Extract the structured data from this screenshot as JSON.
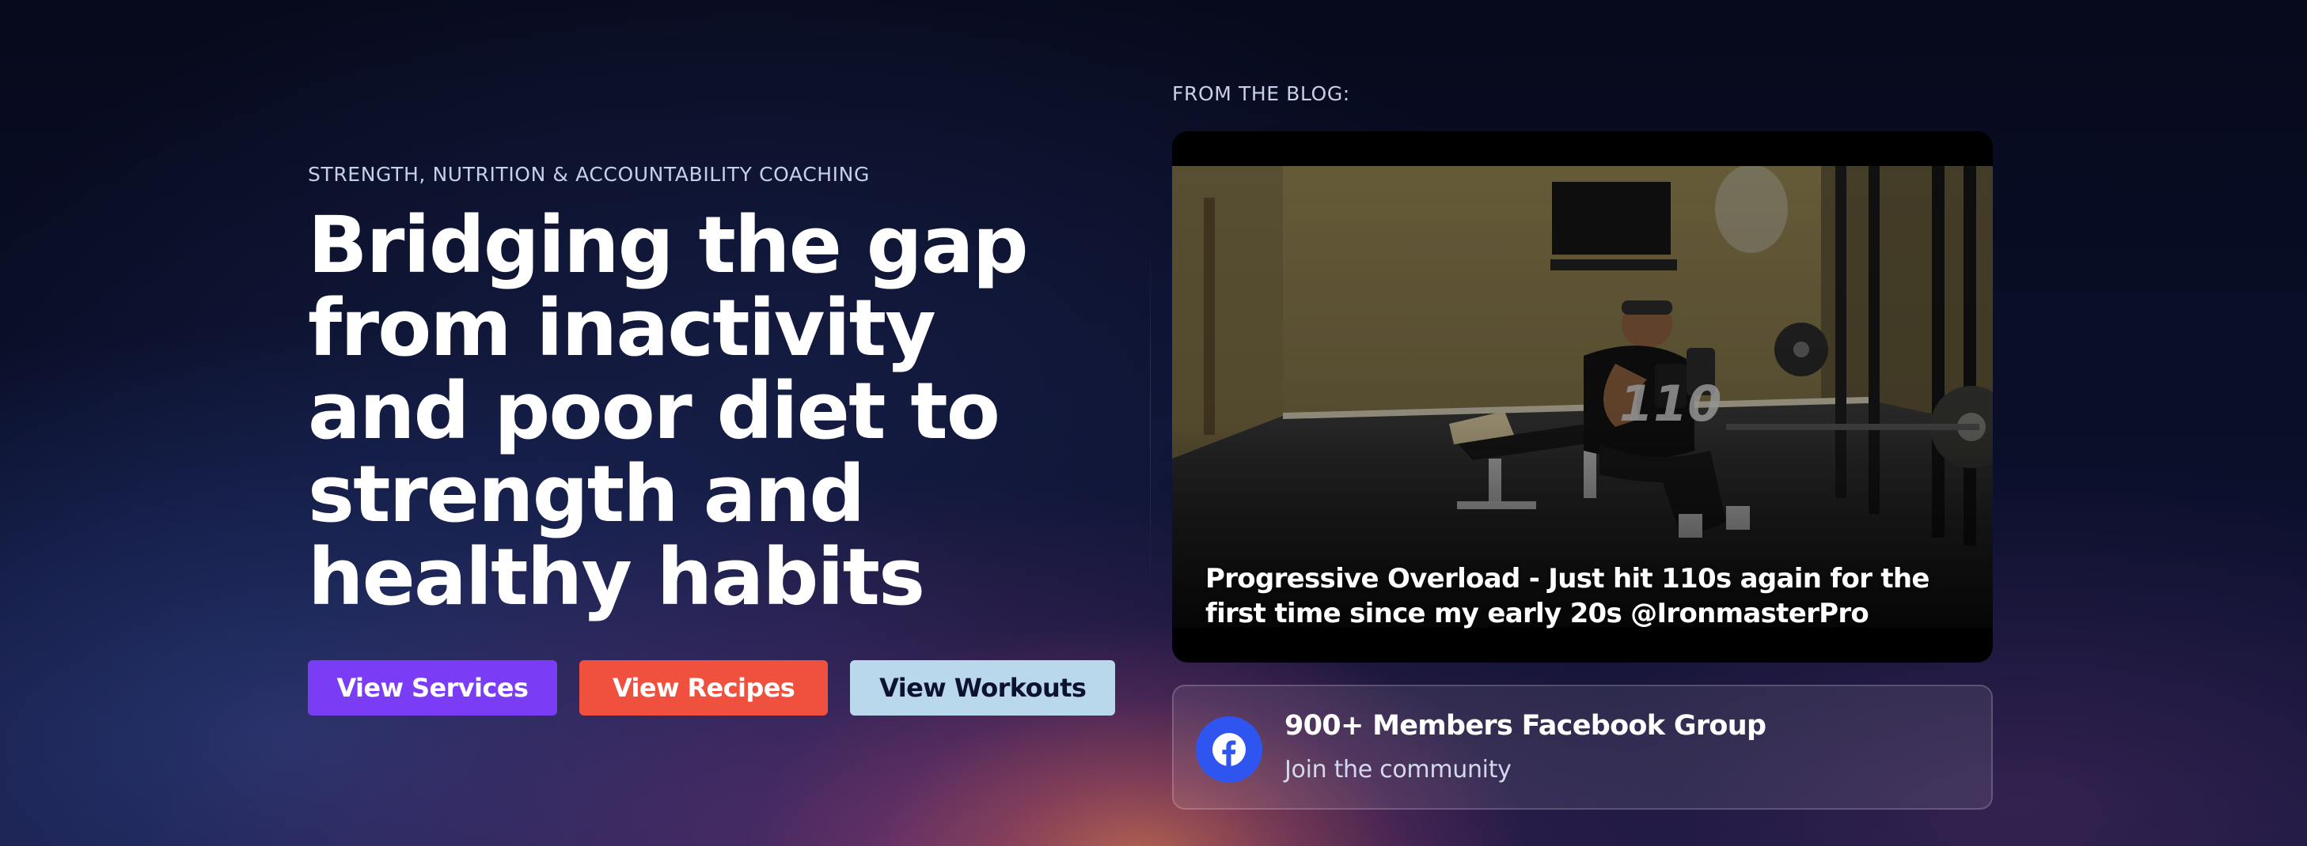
{
  "hero": {
    "eyebrow": "STRENGTH, NUTRITION & ACCOUNTABILITY COACHING",
    "headline": "Bridging the gap from inactivity and poor diet to strength and healthy habits",
    "buttons": {
      "services": "View Services",
      "recipes": "View Recipes",
      "workouts": "View Workouts"
    }
  },
  "blog": {
    "label": "FROM THE BLOG:",
    "post": {
      "caption": "Progressive Overload - Just hit 110s again for the first time since my early 20s @IronmasterPro",
      "image_overlay_text": "110"
    }
  },
  "community": {
    "title": "900+ Members Facebook Group",
    "subtitle": "Join the community",
    "icon": "facebook-icon"
  },
  "colors": {
    "services_button": "#7a3cf5",
    "recipes_button": "#f0503e",
    "workouts_button": "#b9d8ec",
    "facebook_blue": "#2f55f0",
    "background_dark": "#070a1c"
  }
}
